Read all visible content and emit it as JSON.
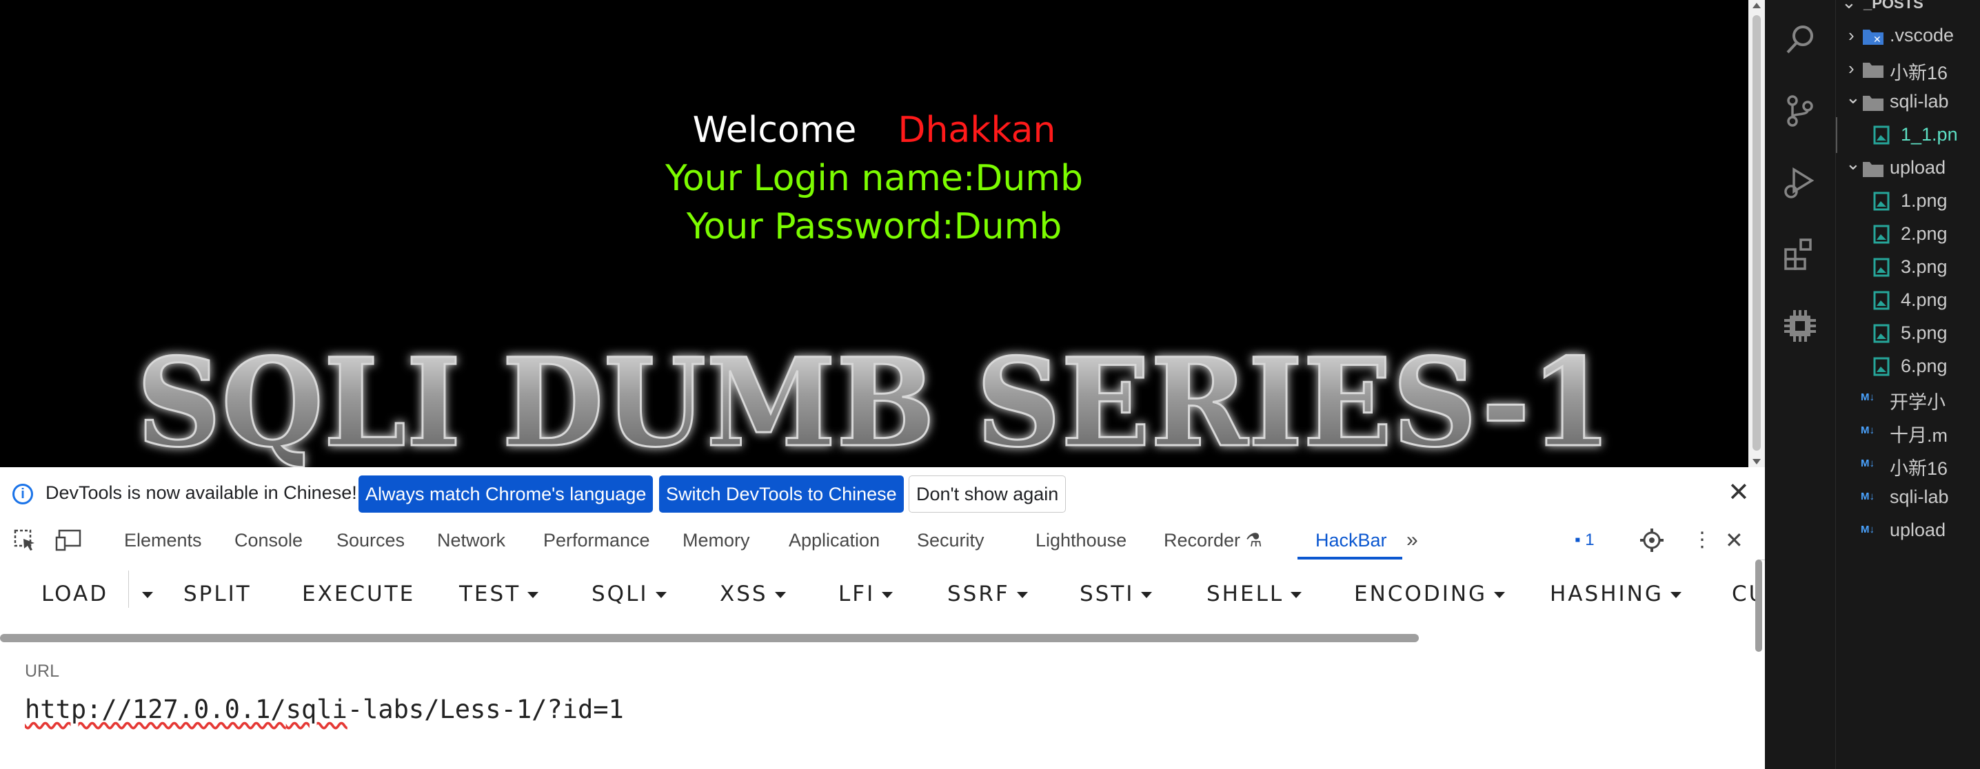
{
  "page": {
    "welcome": "Welcome",
    "name": "Dhakkan",
    "login_line": "Your Login name:Dumb",
    "password_line": "Your Password:Dumb",
    "banner": "SQLI DUMB SERIES-1"
  },
  "infobar": {
    "message": "DevTools is now available in Chinese!",
    "match_button": "Always match Chrome's language",
    "switch_button": "Switch DevTools to Chinese",
    "dont_show_button": "Don't show again"
  },
  "tabs": [
    "Elements",
    "Console",
    "Sources",
    "Network",
    "Performance",
    "Memory",
    "Application",
    "Security",
    "Lighthouse",
    "Recorder",
    "HackBar"
  ],
  "active_tab": "HackBar",
  "issues_count": "1",
  "hackbar": {
    "menu": [
      "LOAD",
      "SPLIT",
      "EXECUTE",
      "TEST",
      "SQLI",
      "XSS",
      "LFI",
      "SSRF",
      "SSTI",
      "SHELL",
      "ENCODING",
      "HASHING",
      "CU"
    ],
    "url_label": "URL",
    "url_parts": [
      "http://127.0.0.1/",
      "sqli",
      "-labs/Less-1/?id=1"
    ]
  },
  "explorer": {
    "section": "_POSTS",
    "items": [
      ".vscode",
      "小新16",
      "sqli-lab",
      "1_1.pn",
      "upload",
      "1.png",
      "2.png",
      "3.png",
      "4.png",
      "5.png",
      "6.png",
      "开学小",
      "十月.m",
      "小新16",
      "sqli-lab",
      "upload"
    ]
  },
  "colors": {
    "accent": "#0b57d0",
    "name_red": "#ff1a1a",
    "green_text": "#7cfc00"
  }
}
